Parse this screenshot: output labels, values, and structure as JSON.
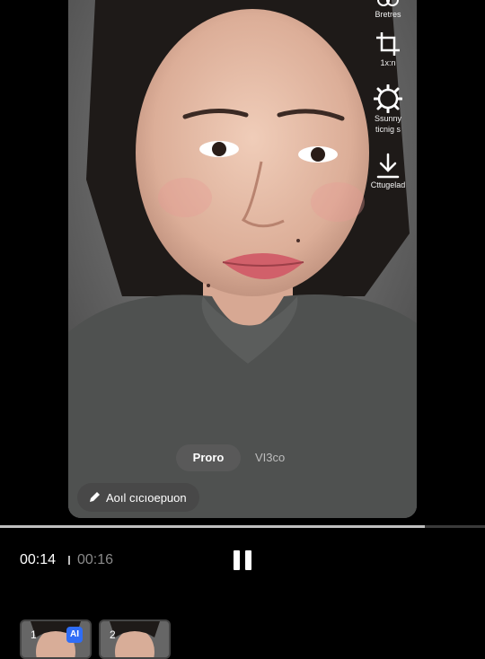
{
  "side_tools": [
    {
      "label": "Bretres",
      "icon": "effects-icon"
    },
    {
      "label": "1x:n",
      "icon": "crop-icon"
    },
    {
      "label": "Ssunny\nticnig s",
      "icon": "settings-gear-icon"
    },
    {
      "label": "Cttugelad",
      "icon": "download-icon"
    }
  ],
  "modes": {
    "active": "Proro",
    "inactive": "VI3co"
  },
  "ai_description_button": "Aoıl cıcıoepuon",
  "player": {
    "current_time": "00:14",
    "total_time": "00:16",
    "progress_fraction": 0.875
  },
  "thumbnails": [
    {
      "number": "1",
      "badge": "AI"
    },
    {
      "number": "2",
      "badge": ""
    }
  ]
}
